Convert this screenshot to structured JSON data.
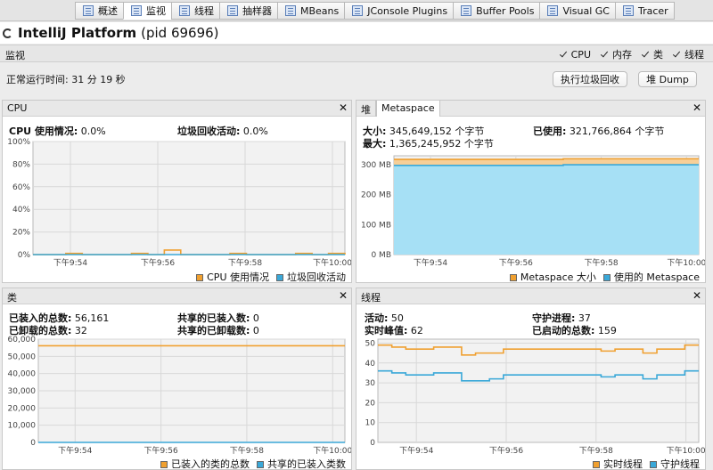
{
  "tabs": [
    {
      "label": "概述",
      "icon": "overview-icon"
    },
    {
      "label": "监视",
      "icon": "monitor-icon",
      "active": true
    },
    {
      "label": "线程",
      "icon": "threads-icon"
    },
    {
      "label": "抽样器",
      "icon": "sampler-icon"
    },
    {
      "label": "MBeans",
      "icon": "mbeans-icon"
    },
    {
      "label": "JConsole Plugins",
      "icon": "jconsole-icon"
    },
    {
      "label": "Buffer Pools",
      "icon": "buffer-pools-icon"
    },
    {
      "label": "Visual GC",
      "icon": "visual-gc-icon"
    },
    {
      "label": "Tracer",
      "icon": "tracer-icon"
    }
  ],
  "header": {
    "app": "IntelliJ Platform",
    "pid": "(pid 69696)"
  },
  "monitor": {
    "label": "监视",
    "checks": [
      "CPU",
      "内存",
      "类",
      "线程"
    ],
    "uptime": "正常运行时间: 31 分 19 秒",
    "gc_button": "执行垃圾回收",
    "heap_dump_button": "堆 Dump"
  },
  "colors": {
    "orange": "#f0a030",
    "blue": "#3aa8d8",
    "blue_fill": "#a6e0f5"
  },
  "cpu": {
    "title": "CPU",
    "usage_label": "CPU 使用情况:",
    "usage_value": "0.0%",
    "gc_label": "垃圾回收活动:",
    "gc_value": "0.0%",
    "legend": [
      "CPU 使用情况",
      "垃圾回收活动"
    ]
  },
  "heap": {
    "tabs": [
      "堆",
      "Metaspace"
    ],
    "size_label": "大小:",
    "size_value": "345,649,152 个字节",
    "max_label": "最大:",
    "max_value": "1,365,245,952 个字节",
    "used_label": "已使用:",
    "used_value": "321,766,864 个字节",
    "legend": [
      "Metaspace 大小",
      "使用的 Metaspace"
    ]
  },
  "classes": {
    "title": "类",
    "loaded_label": "已装入的总数:",
    "loaded_value": "56,161",
    "unloaded_label": "已卸载的总数:",
    "unloaded_value": "32",
    "shared_loaded_label": "共享的已装入数:",
    "shared_loaded_value": "0",
    "shared_unloaded_label": "共享的已卸载数:",
    "shared_unloaded_value": "0",
    "legend": [
      "已装入的类的总数",
      "共享的已装入类数"
    ]
  },
  "threads": {
    "title": "线程",
    "live_label": "活动:",
    "live_value": "50",
    "peak_label": "实时峰值:",
    "peak_value": "62",
    "daemon_label": "守护进程:",
    "daemon_value": "37",
    "started_label": "已启动的总数:",
    "started_value": "159",
    "legend": [
      "实时线程",
      "守护线程"
    ]
  },
  "chart_data": [
    {
      "type": "line",
      "name": "cpu",
      "x": [
        "下午9:54",
        "下午9:56",
        "下午9:58",
        "下午10:00"
      ],
      "y_ticks": [
        "0%",
        "20%",
        "40%",
        "60%",
        "80%",
        "100%"
      ],
      "ylim": [
        0,
        100
      ],
      "series": [
        {
          "name": "CPU 使用情况",
          "values": [
            0,
            0,
            1,
            0,
            0,
            0,
            1,
            0,
            4,
            0,
            0,
            0,
            1,
            0,
            0,
            0,
            1,
            0,
            1,
            0
          ]
        },
        {
          "name": "垃圾回收活动",
          "values": [
            0,
            0,
            0,
            0,
            0,
            0,
            0,
            0,
            0,
            0,
            0,
            0,
            0,
            0,
            0,
            0,
            0,
            0,
            0,
            0
          ]
        }
      ]
    },
    {
      "type": "area",
      "name": "metaspace",
      "x": [
        "下午9:54",
        "下午9:56",
        "下午9:58",
        "下午10:00"
      ],
      "y_ticks": [
        "0 MB",
        "100 MB",
        "200 MB",
        "300 MB"
      ],
      "ylim": [
        0,
        330
      ],
      "series": [
        {
          "name": "Metaspace 大小",
          "values": [
            318,
            318,
            318,
            318,
            318,
            320,
            320,
            320,
            320,
            320
          ]
        },
        {
          "name": "使用的 Metaspace",
          "values": [
            298,
            298,
            298,
            298,
            298,
            300,
            300,
            300,
            300,
            300
          ]
        }
      ]
    },
    {
      "type": "line",
      "name": "classes",
      "x": [
        "下午9:54",
        "下午9:56",
        "下午9:58",
        "下午10:00"
      ],
      "y_ticks": [
        "0",
        "10,000",
        "20,000",
        "30,000",
        "40,000",
        "50,000",
        "60,000"
      ],
      "ylim": [
        0,
        60000
      ],
      "series": [
        {
          "name": "已装入的类的总数",
          "values": [
            56161,
            56161,
            56161,
            56161,
            56161,
            56161
          ]
        },
        {
          "name": "共享的已装入类数",
          "values": [
            0,
            0,
            0,
            0,
            0,
            0
          ]
        }
      ]
    },
    {
      "type": "line",
      "name": "threads",
      "x": [
        "下午9:54",
        "下午9:56",
        "下午9:58",
        "下午10:00"
      ],
      "y_ticks": [
        "0",
        "10",
        "20",
        "30",
        "40",
        "50"
      ],
      "ylim": [
        0,
        52
      ],
      "series": [
        {
          "name": "实时线程",
          "values": [
            49,
            48,
            47,
            47,
            48,
            48,
            44,
            45,
            45,
            47,
            47,
            47,
            47,
            47,
            47,
            47,
            46,
            47,
            47,
            45,
            47,
            47,
            49,
            49
          ]
        },
        {
          "name": "守护线程",
          "values": [
            36,
            35,
            34,
            34,
            35,
            35,
            31,
            31,
            32,
            34,
            34,
            34,
            34,
            34,
            34,
            34,
            33,
            34,
            34,
            32,
            34,
            34,
            36,
            36
          ]
        }
      ]
    }
  ]
}
